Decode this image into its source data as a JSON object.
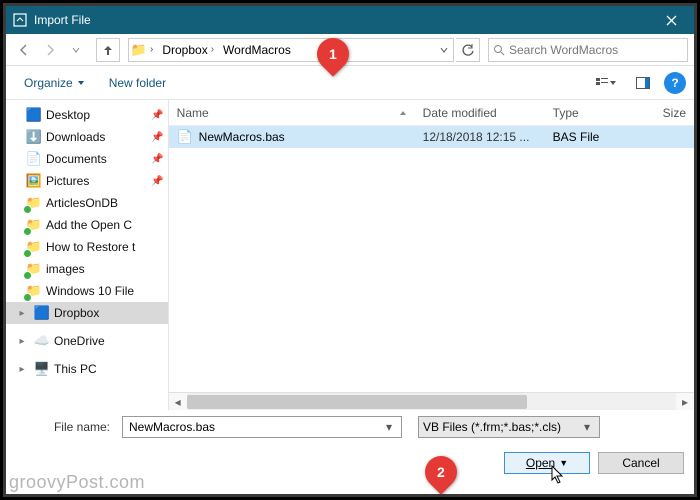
{
  "titlebar": {
    "title": "Import File"
  },
  "nav": {
    "breadcrumb": [
      "Dropbox",
      "WordMacros"
    ],
    "search_placeholder": "Search WordMacros"
  },
  "commands": {
    "organize": "Organize",
    "newfolder": "New folder"
  },
  "tree": {
    "items": [
      {
        "label": "Desktop",
        "icon": "🟦",
        "pinned": true,
        "indent": 1
      },
      {
        "label": "Downloads",
        "icon": "⬇️",
        "pinned": true,
        "indent": 1
      },
      {
        "label": "Documents",
        "icon": "📄",
        "pinned": true,
        "indent": 1
      },
      {
        "label": "Pictures",
        "icon": "🖼️",
        "pinned": true,
        "indent": 1
      },
      {
        "label": "ArticlesOnDB",
        "icon": "📁",
        "pinned": false,
        "indent": 1,
        "sync": true
      },
      {
        "label": "Add the Open C",
        "icon": "📁",
        "pinned": false,
        "indent": 1,
        "sync": true
      },
      {
        "label": "How to Restore t",
        "icon": "📁",
        "pinned": false,
        "indent": 1,
        "sync": true
      },
      {
        "label": "images",
        "icon": "📁",
        "pinned": false,
        "indent": 1,
        "sync": true
      },
      {
        "label": "Windows 10 File",
        "icon": "📁",
        "pinned": false,
        "indent": 1,
        "sync": true
      },
      {
        "label": "Dropbox",
        "icon": "🟦",
        "pinned": false,
        "indent": 0,
        "selected": true,
        "expander": "▸"
      },
      {
        "label": "",
        "spacer": true
      },
      {
        "label": "OneDrive",
        "icon": "☁️",
        "pinned": false,
        "indent": 0,
        "expander": "▸"
      },
      {
        "label": "",
        "spacer": true
      },
      {
        "label": "This PC",
        "icon": "🖥️",
        "pinned": false,
        "indent": 0,
        "expander": "▸"
      }
    ]
  },
  "columns": {
    "name": "Name",
    "date": "Date modified",
    "type": "Type",
    "size": "Size"
  },
  "files": [
    {
      "name": "NewMacros.bas",
      "date": "12/18/2018 12:15 ...",
      "type": "BAS File",
      "size": ""
    }
  ],
  "footer": {
    "label": "File name:",
    "filename": "NewMacros.bas",
    "filetype": "VB Files (*.frm;*.bas;*.cls)",
    "open": "Open",
    "cancel": "Cancel"
  },
  "annotations": {
    "a1": "1",
    "a2": "2"
  },
  "watermark": "groovyPost.com"
}
